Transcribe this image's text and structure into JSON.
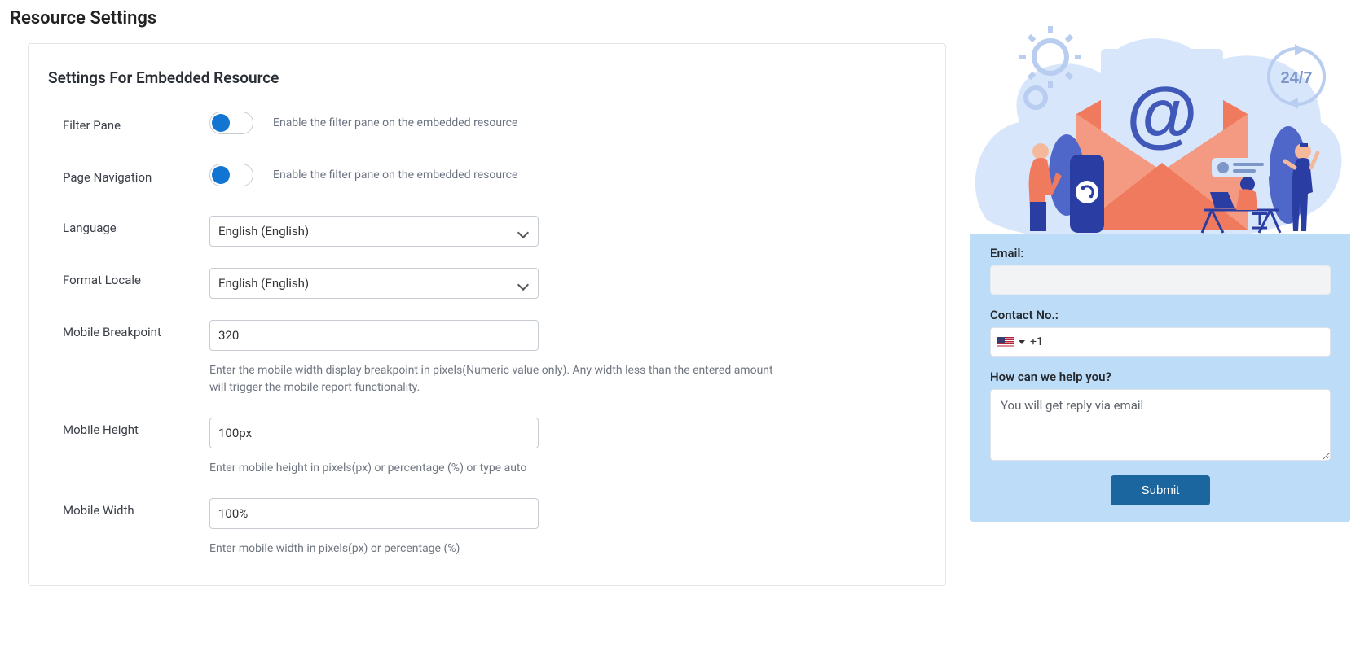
{
  "page_title": "Resource Settings",
  "card_title": "Settings For Embedded Resource",
  "fields": {
    "filter_pane": {
      "label": "Filter Pane",
      "desc": "Enable the filter pane on the embedded resource",
      "on": true
    },
    "page_nav": {
      "label": "Page Navigation",
      "desc": "Enable the filter pane on the embedded resource",
      "on": true
    },
    "language": {
      "label": "Language",
      "value": "English (English)"
    },
    "format_locale": {
      "label": "Format Locale",
      "value": "English (English)"
    },
    "mobile_breakpoint": {
      "label": "Mobile Breakpoint",
      "value": "320",
      "help": "Enter the mobile width display breakpoint in pixels(Numeric value only). Any width less than the entered amount will trigger the mobile report functionality."
    },
    "mobile_height": {
      "label": "Mobile Height",
      "value": "100px",
      "help": "Enter mobile height in pixels(px) or percentage (%) or type auto"
    },
    "mobile_width": {
      "label": "Mobile Width",
      "value": "100%",
      "help": "Enter mobile width in pixels(px) or percentage (%)"
    }
  },
  "contact": {
    "email_label": "Email:",
    "email_value": "",
    "contact_no_label": "Contact No.:",
    "phone_prefix": "+1",
    "help_label": "How can we help you?",
    "message_placeholder": "You will get reply via email",
    "submit_label": "Submit",
    "badge_text": "24/7"
  }
}
